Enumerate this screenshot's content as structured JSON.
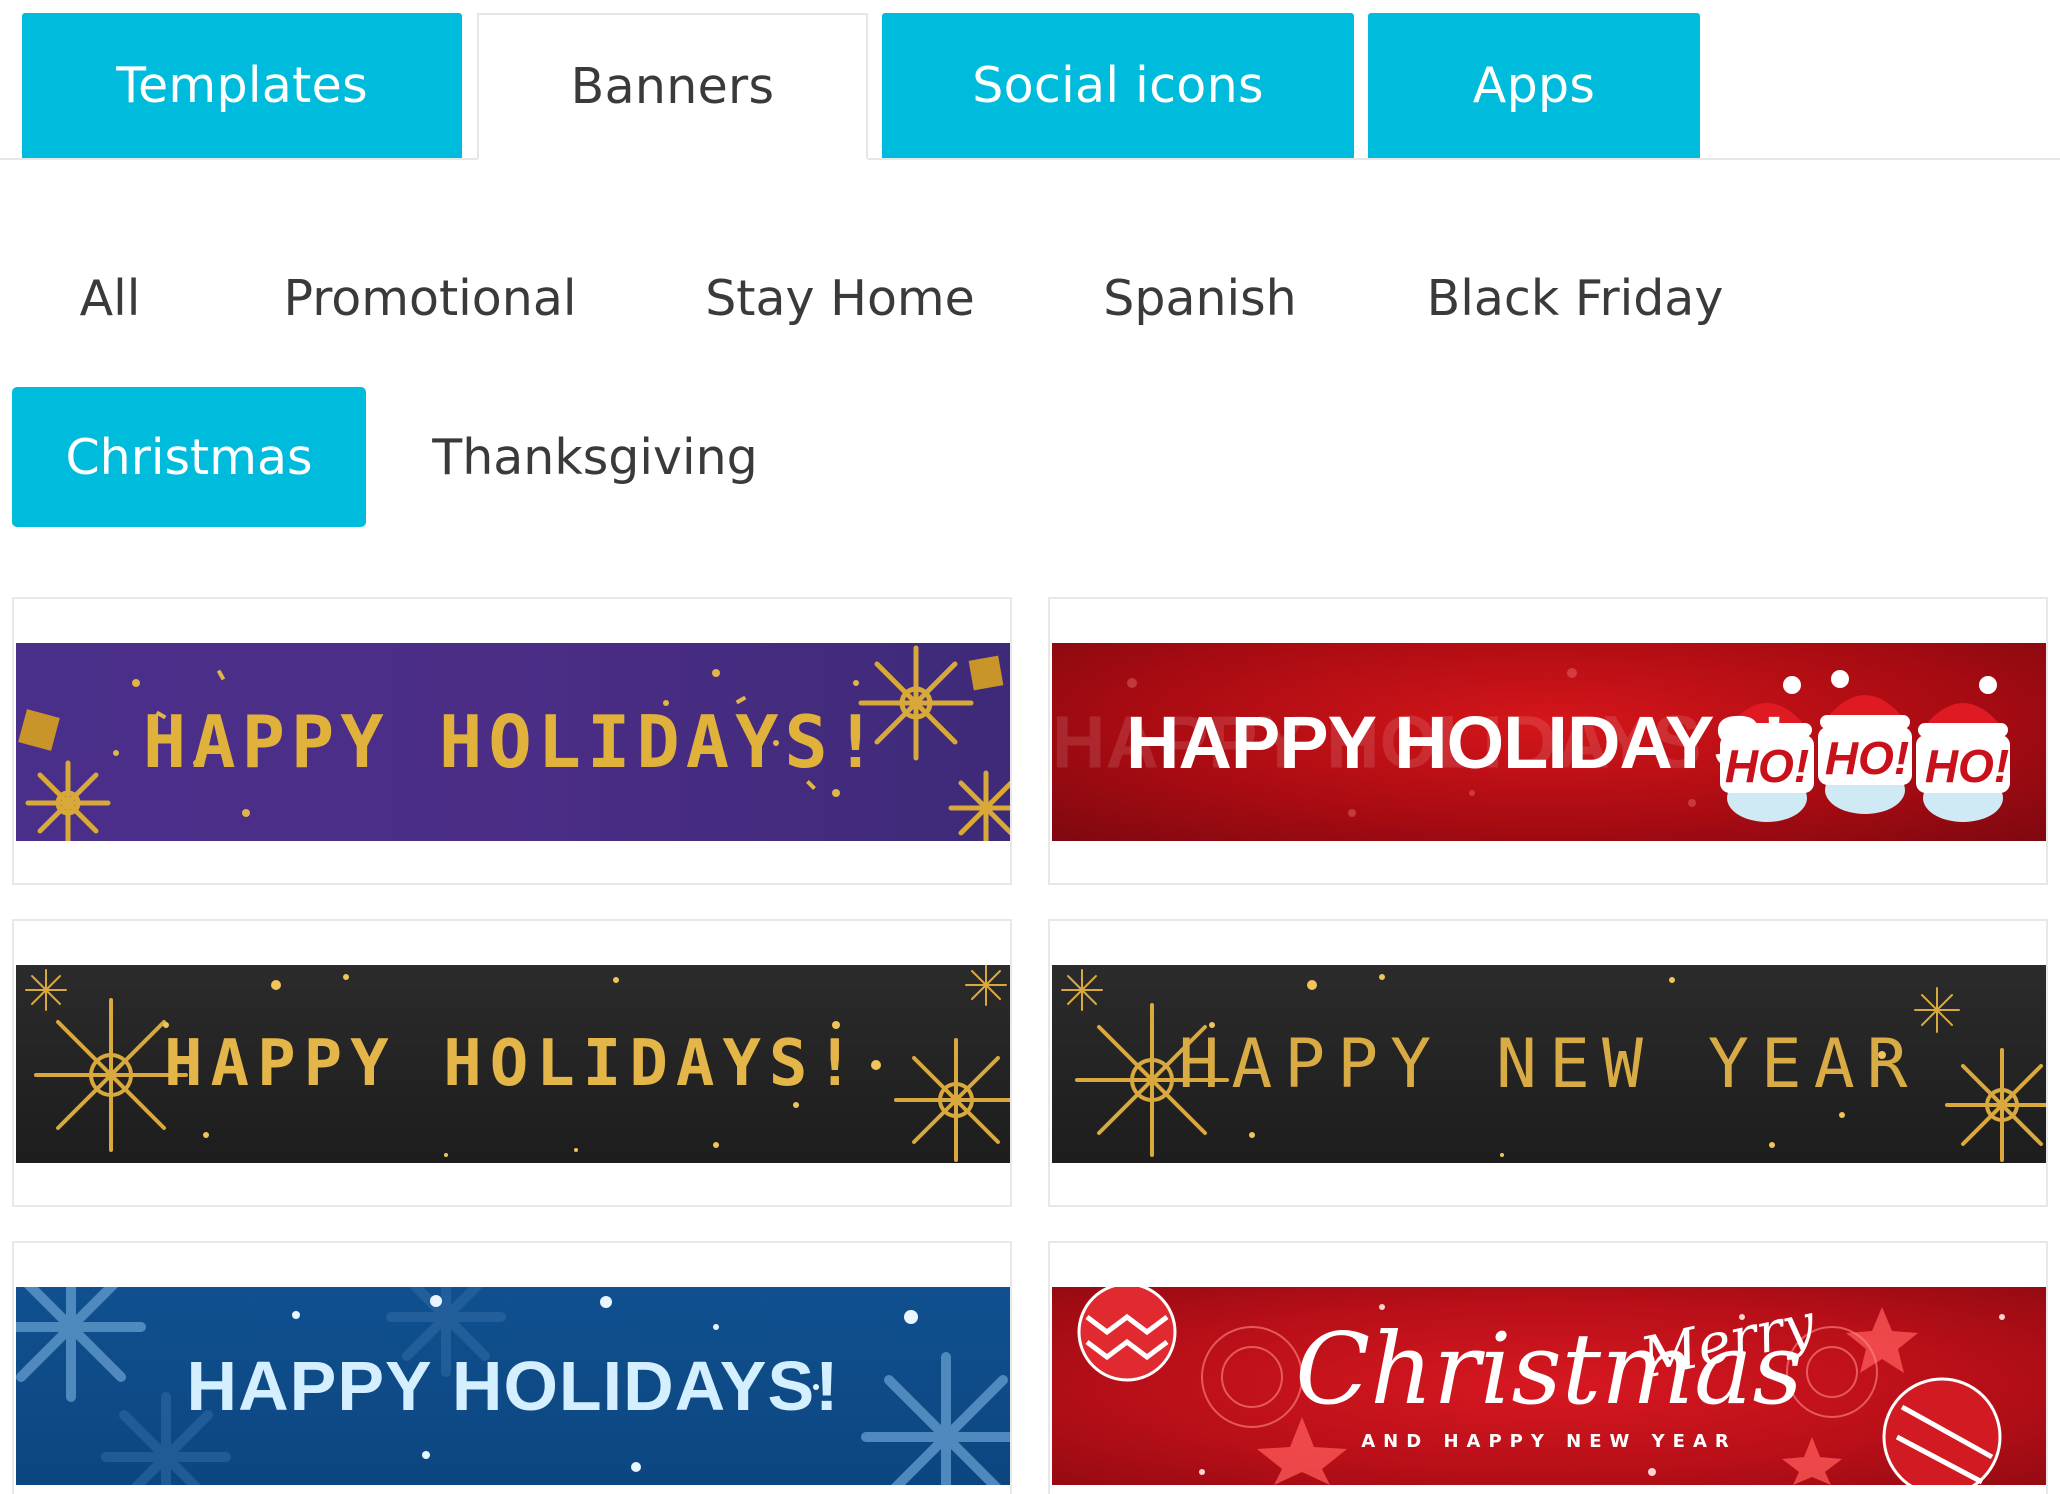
{
  "tabs": [
    {
      "label": "Templates",
      "state": "filled"
    },
    {
      "label": "Banners",
      "state": "active"
    },
    {
      "label": "Social icons",
      "state": "filled"
    },
    {
      "label": "Apps",
      "state": "filled"
    }
  ],
  "filters": [
    {
      "label": "All"
    },
    {
      "label": "Promotional"
    },
    {
      "label": "Stay Home"
    },
    {
      "label": "Spanish"
    },
    {
      "label": "Black Friday"
    },
    {
      "label": "Christmas",
      "selected": true
    },
    {
      "label": "Thanksgiving"
    }
  ],
  "banners": [
    {
      "text": "HAPPY HOLIDAYS!",
      "style": "purple-gold"
    },
    {
      "text": "HAPPY HOLIDAYS!",
      "ghost": "HAPPY HOLIDAYS",
      "badge": [
        "HO!",
        "HO!",
        "HO!"
      ],
      "style": "red-santa"
    },
    {
      "text": "HAPPY HOLIDAYS!",
      "style": "black-gold"
    },
    {
      "text": "HAPPY NEW YEAR",
      "style": "black-gold-thin"
    },
    {
      "text": "HAPPY HOLIDAYS!",
      "style": "blue-snow"
    },
    {
      "script": "Christmas",
      "merry": "Merry",
      "sub": "AND HAPPY NEW YEAR",
      "style": "red-ornaments"
    }
  ],
  "colors": {
    "accent": "#00bcdc",
    "gold": "#e0b23c",
    "purple": "#4a2f8a",
    "red": "#c8111a",
    "dark": "#222222",
    "blue": "#0f4d8c"
  }
}
